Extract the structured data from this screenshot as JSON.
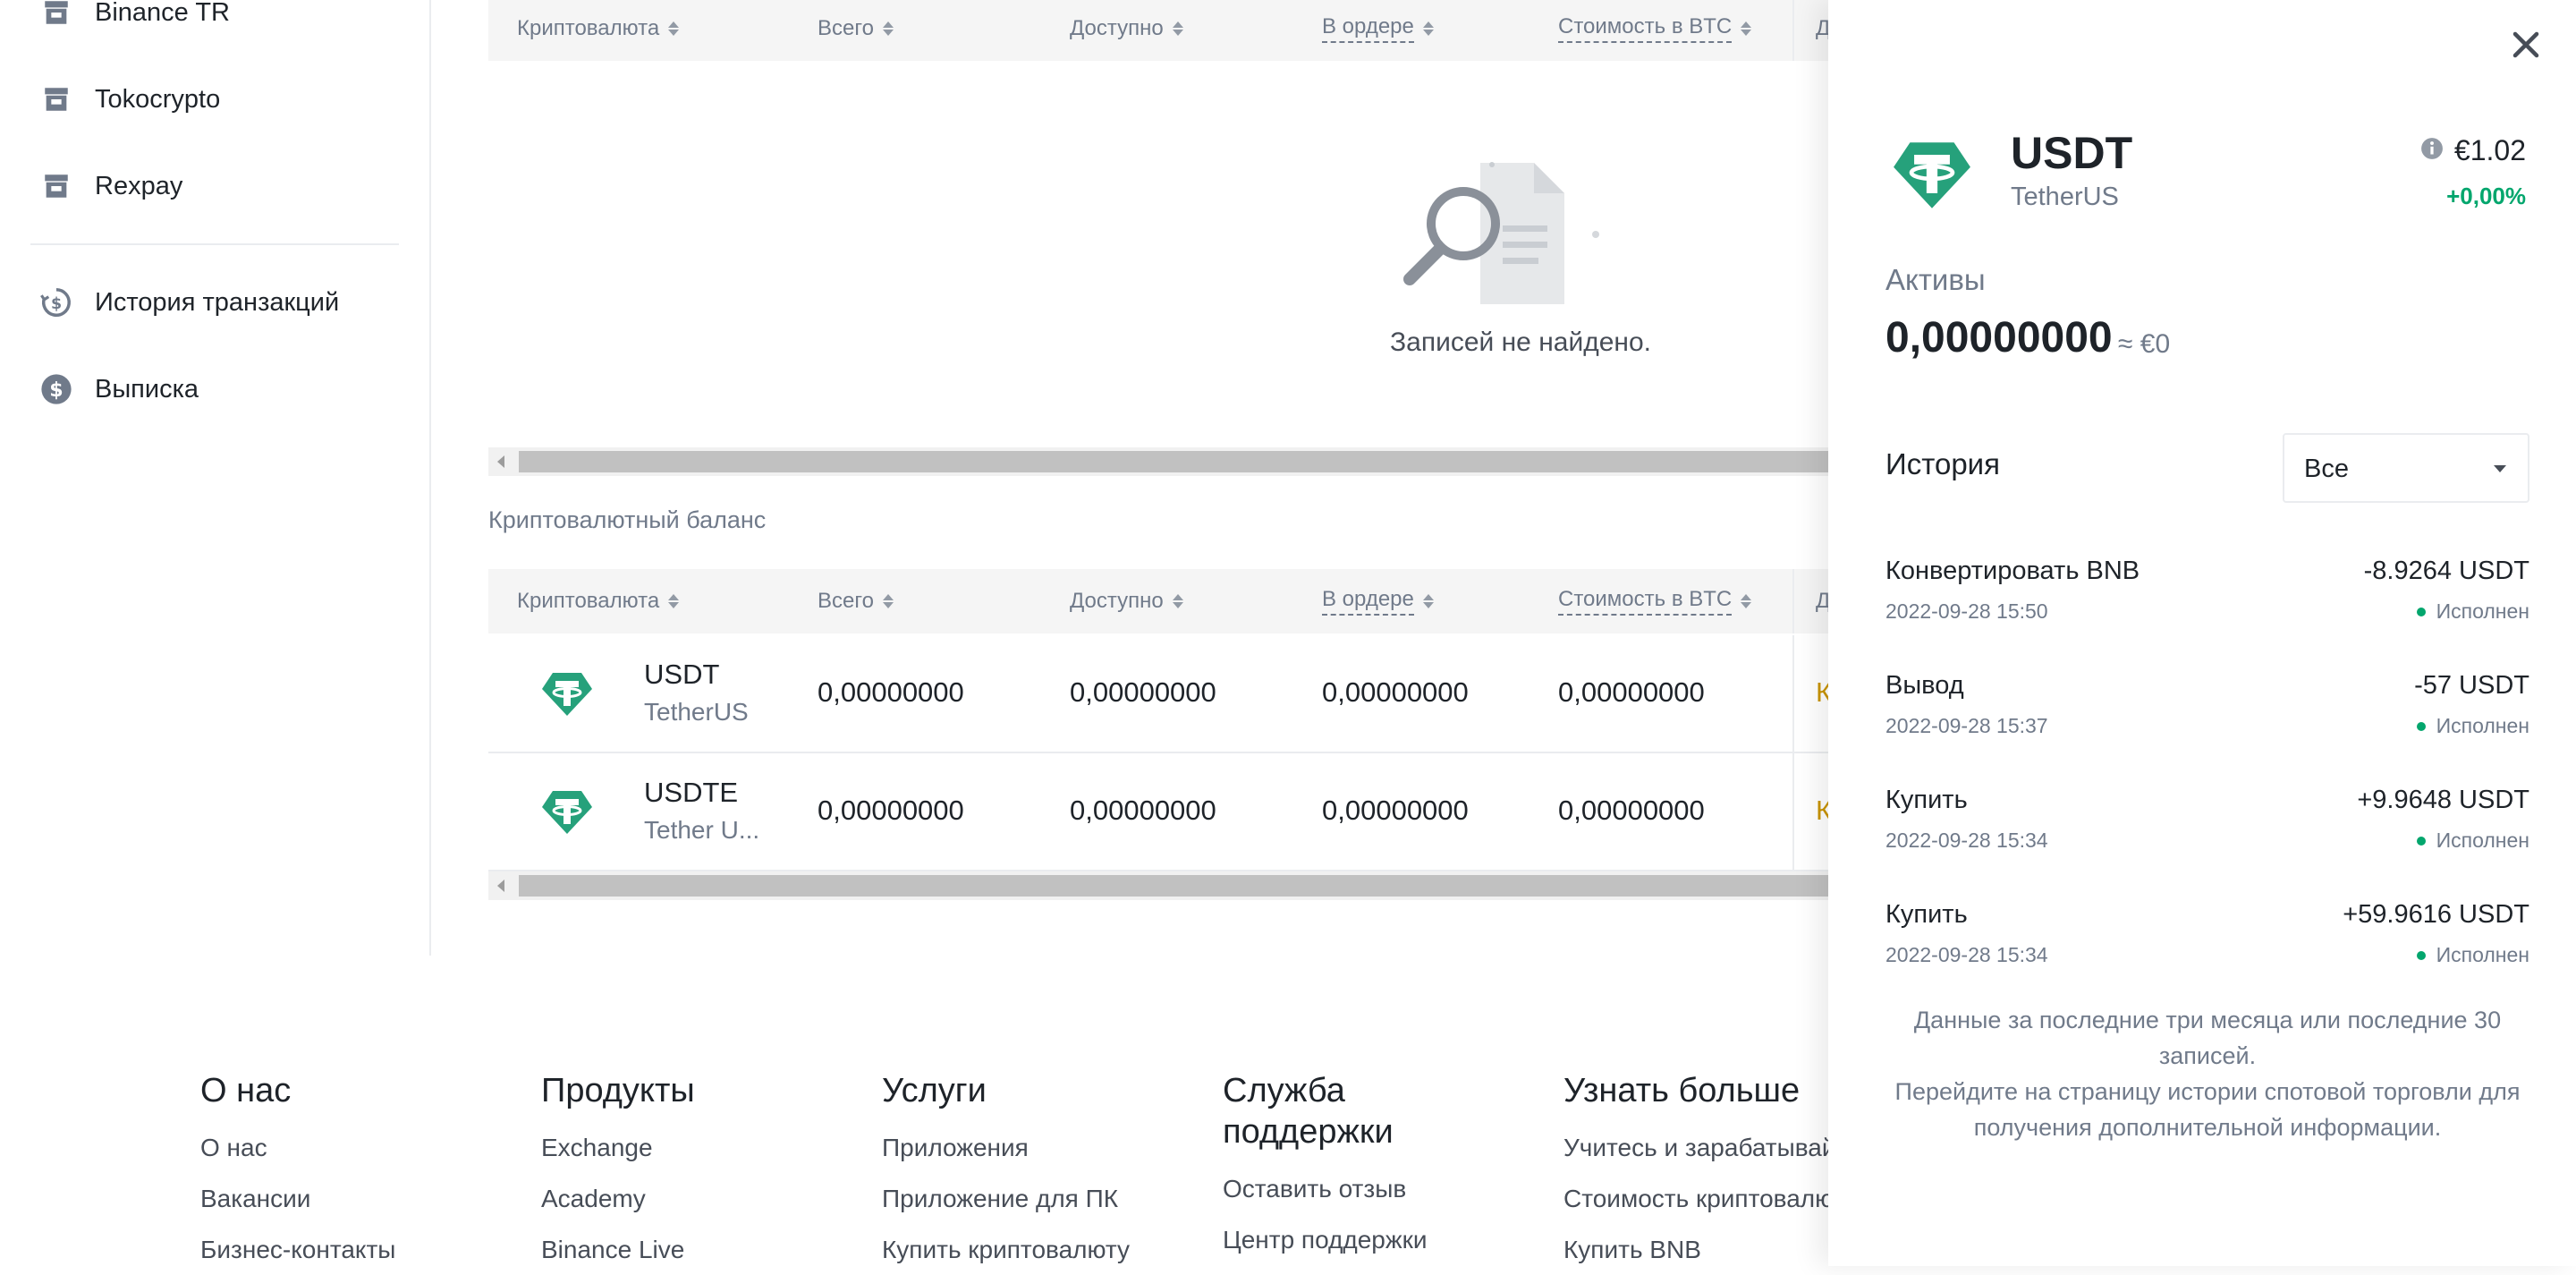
{
  "sidebar": {
    "items": [
      {
        "label": "Binance TR",
        "icon": "store-icon"
      },
      {
        "label": "Tokocrypto",
        "icon": "store-icon"
      },
      {
        "label": "Rexpay",
        "icon": "store-icon"
      },
      {
        "label": "История транзакций",
        "icon": "history-dollar-icon"
      },
      {
        "label": "Выписка",
        "icon": "dollar-coin-icon"
      }
    ]
  },
  "table_headers": {
    "crypto": "Криптовалюта",
    "total": "Всего",
    "available": "Доступно",
    "in_order": "В ордере",
    "btc_value": "Стоимость в BTC",
    "cut": "Д"
  },
  "empty_state": {
    "text": "Записей не найдено."
  },
  "balance": {
    "title": "Криптовалютный баланс",
    "rows": [
      {
        "symbol": "USDT",
        "name": "TetherUS",
        "total": "0,00000000",
        "available": "0,00000000",
        "in_order": "0,00000000",
        "btc_value": "0,00000000",
        "cut_link": "К"
      },
      {
        "symbol": "USDTE",
        "name": "Tether U...",
        "total": "0,00000000",
        "available": "0,00000000",
        "in_order": "0,00000000",
        "btc_value": "0,00000000",
        "cut_link": "К"
      }
    ]
  },
  "footer": {
    "columns": [
      {
        "title": "О нас",
        "links": [
          "О нас",
          "Вакансии",
          "Бизнес-контакты"
        ]
      },
      {
        "title": "Продукты",
        "links": [
          "Exchange",
          "Academy",
          "Binance Live"
        ]
      },
      {
        "title": "Услуги",
        "links": [
          "Приложения",
          "Приложение для ПК",
          "Купить криптовалюту"
        ]
      },
      {
        "title": "Служба поддержки",
        "links": [
          "Оставить отзыв",
          "Центр поддержки"
        ]
      },
      {
        "title": "Узнать больше",
        "links": [
          "Учитесь и зарабатывайте",
          "Стоимость криптовалют",
          "Купить BNB"
        ]
      }
    ]
  },
  "drawer": {
    "symbol": "USDT",
    "name": "TetherUS",
    "price": "€1.02",
    "change": "+0,00%",
    "assets_label": "Активы",
    "assets_value": "0,00000000",
    "assets_approx": "≈ €0",
    "history_label": "История",
    "filter_value": "Все",
    "history": [
      {
        "type": "Конвертировать BNB",
        "amount": "-8.9264 USDT",
        "time": "2022-09-28 15:50",
        "status": "Исполнен"
      },
      {
        "type": "Вывод",
        "amount": "-57 USDT",
        "time": "2022-09-28 15:37",
        "status": "Исполнен"
      },
      {
        "type": "Купить",
        "amount": "+9.9648 USDT",
        "time": "2022-09-28 15:34",
        "status": "Исполнен"
      },
      {
        "type": "Купить",
        "amount": "+59.9616 USDT",
        "time": "2022-09-28 15:34",
        "status": "Исполнен"
      }
    ],
    "note_line1": "Данные за последние три месяца или последние 30 записей.",
    "note_line2": "Перейдите на страницу истории спотовой торговли для получения дополнительной информации."
  },
  "colors": {
    "accent_green": "#03a66d",
    "link_gold": "#c99400",
    "tether_green": "#26a17b"
  }
}
